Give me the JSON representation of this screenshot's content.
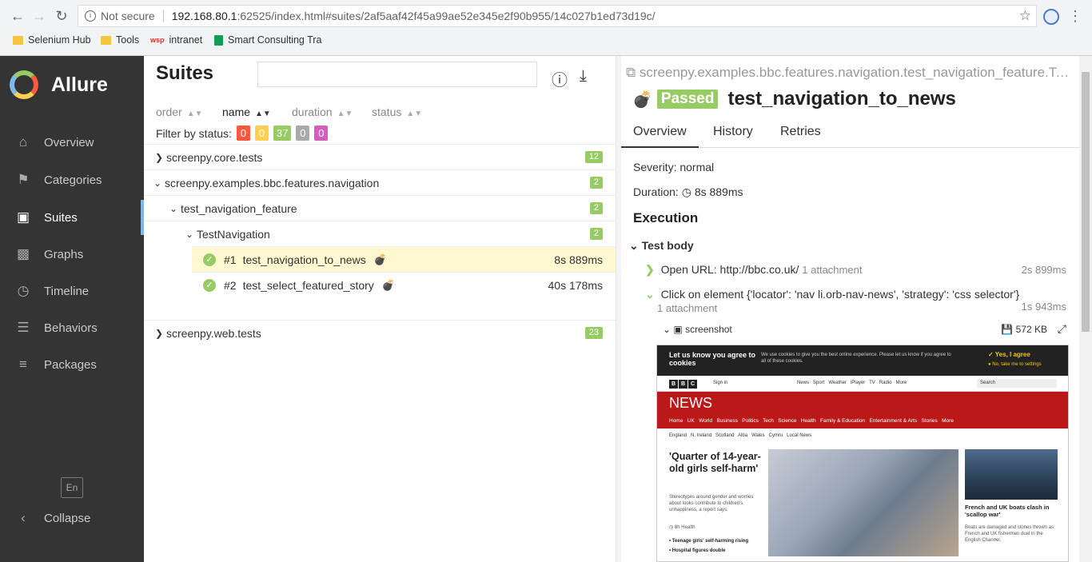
{
  "browser": {
    "security": "Not secure",
    "url_host": "192.168.80.1",
    "url_rest": ":62525/index.html#suites/2af5aaf42f45a99ae52e345e2f90b955/14c027b1ed73d19c/",
    "bookmarks": [
      "Selenium Hub",
      "Tools",
      "intranet",
      "Smart Consulting Tra"
    ]
  },
  "sidebar": {
    "brand": "Allure",
    "items": [
      {
        "label": "Overview"
      },
      {
        "label": "Categories"
      },
      {
        "label": "Suites"
      },
      {
        "label": "Graphs"
      },
      {
        "label": "Timeline"
      },
      {
        "label": "Behaviors"
      },
      {
        "label": "Packages"
      }
    ],
    "lang": "En",
    "collapse": "Collapse"
  },
  "suites": {
    "title": "Suites",
    "sort": [
      "order",
      "name",
      "duration",
      "status"
    ],
    "filter_label": "Filter by status:",
    "status_counts": [
      {
        "value": "0",
        "color": "#fd5a3e"
      },
      {
        "value": "0",
        "color": "#ffd050"
      },
      {
        "value": "37",
        "color": "#97cc64"
      },
      {
        "value": "0",
        "color": "#aaaaaa"
      },
      {
        "value": "0",
        "color": "#d35ebe"
      }
    ],
    "tree": [
      {
        "label": "screenpy.core.tests",
        "count": "12"
      },
      {
        "label": "screenpy.examples.bbc.features.navigation",
        "count": "2"
      },
      {
        "label": "test_navigation_feature",
        "count": "2"
      },
      {
        "label": "TestNavigation",
        "count": "2"
      },
      {
        "num": "#1",
        "label": "test_navigation_to_news",
        "duration": "8s 889ms"
      },
      {
        "num": "#2",
        "label": "test_select_featured_story",
        "duration": "40s 178ms"
      },
      {
        "label": "screenpy.web.tests",
        "count": "23"
      }
    ]
  },
  "detail": {
    "breadcrumb": "screenpy.examples.bbc.features.navigation.test_navigation_feature.TestNavigation",
    "status": "Passed",
    "title": "test_navigation_to_news",
    "tabs": [
      "Overview",
      "History",
      "Retries"
    ],
    "severity": "Severity: normal",
    "duration_label": "Duration:",
    "duration": "8s 889ms",
    "execution": "Execution",
    "test_body": "Test body",
    "steps": [
      {
        "label": "Open URL: http://bbc.co.uk/",
        "attach": "1 attachment",
        "duration": "2s 899ms"
      },
      {
        "label": "Click on element {'locator': 'nav li.orb-nav-news', 'strategy': 'css selector'}",
        "attach": "1 attachment",
        "duration": "1s 943ms"
      }
    ],
    "attachment_name": "screenshot",
    "attachment_size": "572 KB"
  },
  "bbc": {
    "cookie_title": "Let us know you agree to cookies",
    "cookie_text": "We use cookies to give you the best online experience. Please let us know if you agree to all of these cookies.",
    "agree": "Yes, I agree",
    "settings": "No, take me to settings",
    "logo": [
      "B",
      "B",
      "C"
    ],
    "signin": "Sign in",
    "topnav": "News   Sport   Weather   iPlayer   TV   Radio   More",
    "search": "Search",
    "news": "NEWS",
    "newsnav": "Home   UK   World   Business   Politics   Tech   Science   Health   Family & Education   Entertainment & Arts   Stories   More",
    "subnav": "England   N. Ireland   Scotland   Alba   Wales   Cymru   Local News",
    "lead_title": "'Quarter of 14-year-old girls self-harm'",
    "lead_summary": "Stereotypes around gender and worries about looks contribute to children's unhappiness, a report says.",
    "lead_meta": "8h  Health",
    "bullets": [
      "Teenage girls' self-harming rising",
      "Hospital figures double"
    ],
    "side_title": "French and UK boats clash in 'scallop war'",
    "side_summary": "Boats are damaged and stones thrown as French and UK fishermen duel in the English Channel."
  }
}
